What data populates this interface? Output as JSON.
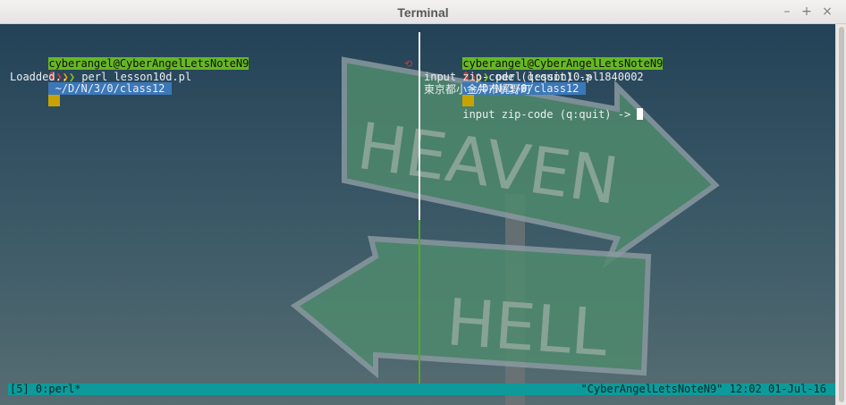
{
  "window": {
    "title": "Terminal"
  },
  "controls": {
    "minimize": "–",
    "maximize": "+",
    "close": "×"
  },
  "pane_left": {
    "prompt": {
      "user_host": "cyberangel@CyberAngelLetsNoteN9",
      "dollar": "$",
      "path": " ~/D/N/3/0/class12 "
    },
    "chevrons": "❯",
    "command": " perl lesson10d.pl",
    "output": [
      "Loadded.."
    ]
  },
  "pane_right": {
    "prompt": {
      "user_host": "cyberangel@CyberAngelLetsNoteN9",
      "dollar": "$",
      "path": " ~/D/N/3/0/class12 "
    },
    "chevrons": "❯",
    "command": " perl lesson10.pl",
    "output": [
      "input zip-code (q:quit) -> 1840002",
      "東京都小金井市梶野町",
      "input zip-code (q:quit) -> "
    ]
  },
  "background_text": {
    "sign_top": "HEAVEN",
    "sign_bottom": "HELL"
  },
  "status": {
    "left": "[5] 0:perl*",
    "right": "\"CyberAngelLetsNoteN9\" 12:02 01-Jul-16"
  },
  "colors": {
    "status_bg": "#0e9a9a",
    "prompt_user_bg": "#66b822",
    "prompt_path_bg": "#3c78b8",
    "divider_active": "#5aa82a"
  }
}
